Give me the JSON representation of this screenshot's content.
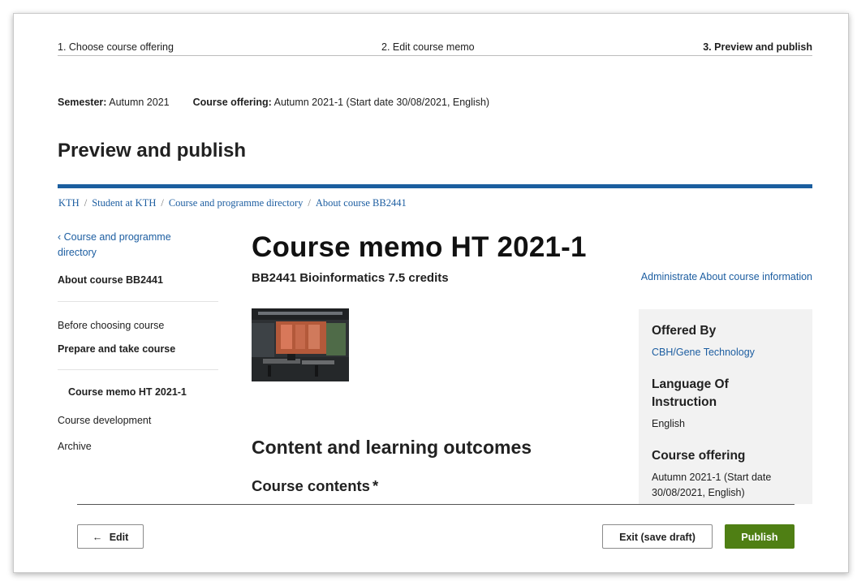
{
  "stepper": {
    "step1": "1. Choose course offering",
    "step2": "2. Edit course memo",
    "step3": "3. Preview and publish"
  },
  "meta": {
    "semester_label": "Semester:",
    "semester_value": "Autumn 2021",
    "offering_label": "Course offering:",
    "offering_value": "Autumn 2021-1 (Start date 30/08/2021, English)"
  },
  "page_title": "Preview and publish",
  "breadcrumb": [
    "KTH",
    "Student at KTH",
    "Course and programme directory",
    "About course BB2441"
  ],
  "sidebar": {
    "back_link": "‹ Course and programme directory",
    "about_course": "About course BB2441",
    "before_choosing": "Before choosing course",
    "prepare_take": "Prepare and take course",
    "memo_item": "Course memo HT 2021-1",
    "course_development": "Course development",
    "archive": "Archive"
  },
  "main": {
    "title": "Course memo HT 2021-1",
    "subtitle": "BB2441 Bioinformatics 7.5 credits",
    "admin_link": "Administrate About course information",
    "section_heading": "Content and learning outcomes",
    "subsection_heading": "Course contents",
    "required_marker": "*"
  },
  "info_panel": {
    "offered_by_heading": "Offered By",
    "offered_by_value": "CBH/Gene Technology",
    "language_heading": "Language Of Instruction",
    "language_value": "English",
    "offering_heading": "Course offering",
    "offering_value": "Autumn 2021-1 (Start date 30/08/2021, English)"
  },
  "actions": {
    "edit_arrow": "←",
    "edit_label": "Edit",
    "exit_label": "Exit (save draft)",
    "publish_label": "Publish"
  },
  "colors": {
    "link": "#1d5ea1",
    "accent_bar": "#1b5e9f",
    "publish_button": "#4f7f14",
    "info_panel_bg": "#f2f2f2"
  },
  "icons": {
    "edit_button": "arrow-left-icon",
    "back_link": "chevron-left-icon"
  }
}
